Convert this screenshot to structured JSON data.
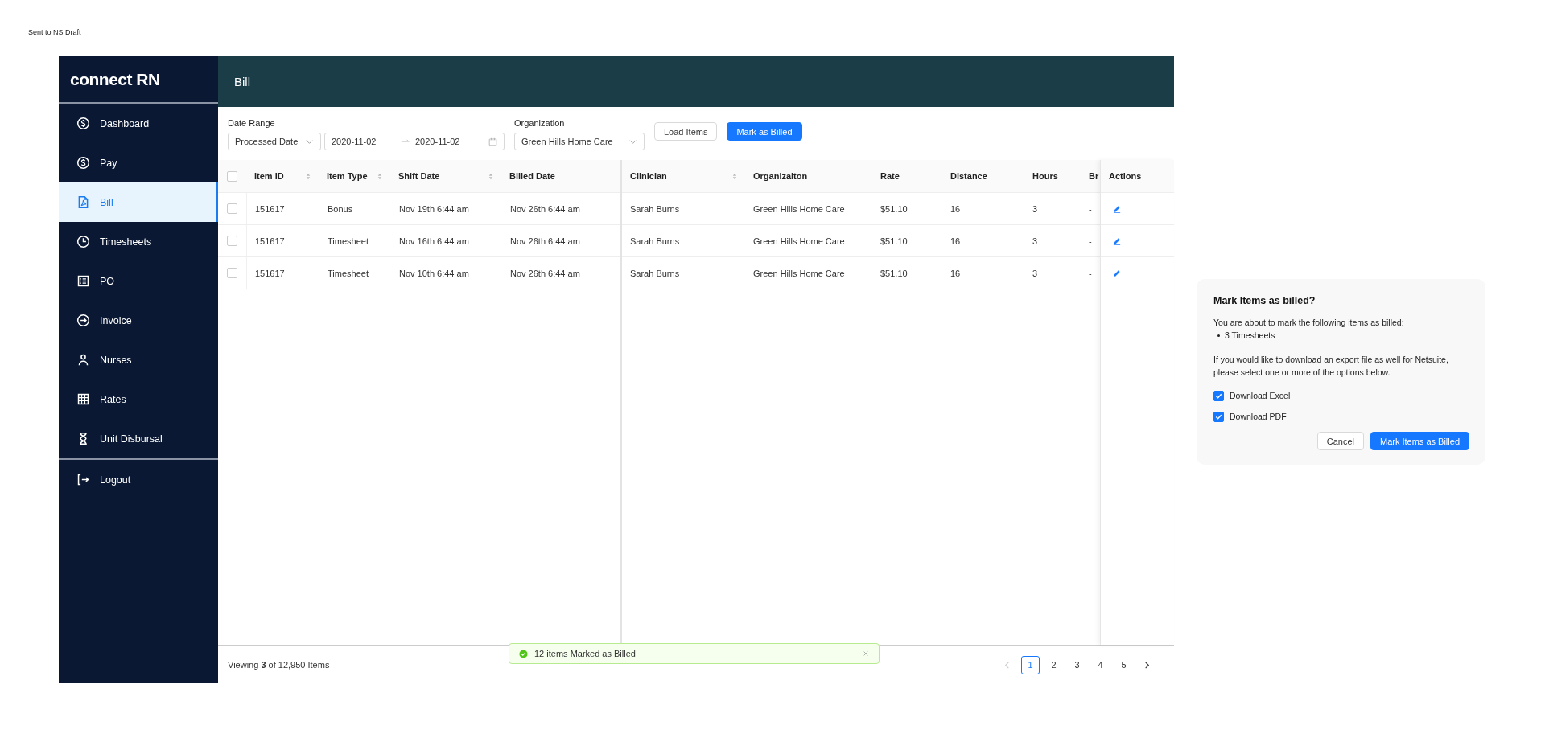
{
  "page_note": "Sent to NS Draft",
  "sidebar": {
    "logo": "connect RN",
    "items": [
      {
        "label": "Dashboard",
        "selected": false
      },
      {
        "label": "Pay",
        "selected": false
      },
      {
        "label": "Bill",
        "selected": true
      },
      {
        "label": "Timesheets",
        "selected": false
      },
      {
        "label": "PO",
        "selected": false
      },
      {
        "label": "Invoice",
        "selected": false
      },
      {
        "label": "Nurses",
        "selected": false
      },
      {
        "label": "Rates",
        "selected": false
      },
      {
        "label": "Unit Disbursal",
        "selected": false
      }
    ],
    "footer_items": [
      {
        "label": "Logout",
        "selected": false
      }
    ]
  },
  "header": {
    "title": "Bill"
  },
  "filters": {
    "date_range_label": "Date Range",
    "date_type": "Processed Date",
    "date_from": "2020-11-02",
    "date_to": "2020-11-02",
    "organization_label": "Organization",
    "organization": "Green Hills Home Care"
  },
  "buttons": [
    {
      "label": "Load Items",
      "kind": "default"
    },
    {
      "label": "Mark as Billed",
      "kind": "primary"
    }
  ],
  "table": {
    "all_checked": false,
    "columns": [
      {
        "label": "Item ID",
        "sortable": true
      },
      {
        "label": "Item Type",
        "sortable": true
      },
      {
        "label": "Shift Date",
        "sortable": true
      },
      {
        "label": "Billed Date",
        "sortable": false
      },
      {
        "label": "Clinician",
        "sortable": true
      },
      {
        "label": "Organizaiton",
        "sortable": false
      },
      {
        "label": "Rate",
        "sortable": false
      },
      {
        "label": "Distance",
        "sortable": false
      },
      {
        "label": "Hours",
        "sortable": false
      },
      {
        "label": "Br",
        "sortable": false
      },
      {
        "label": "Actions",
        "sortable": false
      }
    ],
    "rows": [
      {
        "checked": false,
        "cells": [
          "151617",
          "Bonus",
          "Nov 19th 6:44 am",
          "Nov 26th 6:44 am",
          "Sarah Burns",
          "Green Hills Home Care",
          "$51.10",
          "16",
          "3",
          "-"
        ]
      },
      {
        "checked": false,
        "cells": [
          "151617",
          "Timesheet",
          "Nov 16th 6:44 am",
          "Nov 26th 6:44 am",
          "Sarah Burns",
          "Green Hills Home Care",
          "$51.10",
          "16",
          "3",
          "-"
        ]
      },
      {
        "checked": false,
        "cells": [
          "151617",
          "Timesheet",
          "Nov 10th 6:44 am",
          "Nov 26th 6:44 am",
          "Sarah Burns",
          "Green Hills Home Care",
          "$51.10",
          "16",
          "3",
          "-"
        ]
      }
    ]
  },
  "footer": {
    "summary": "Viewing **3** of 12,950 Items",
    "pages": [
      {
        "label": "1",
        "selected": true
      },
      {
        "label": "2",
        "selected": false
      },
      {
        "label": "3",
        "selected": false
      },
      {
        "label": "4",
        "selected": false
      },
      {
        "label": "5",
        "selected": false
      }
    ],
    "prev_disabled": true,
    "next_disabled": false
  },
  "toast": {
    "message": "12 items Marked as Billed"
  },
  "dialog": {
    "title": "Mark Items as billed?",
    "intro": "You are about to mark the following items as billed:",
    "bullets": [
      "3 Timesheets"
    ],
    "body": "If you would like to download an export file as well for Netsuite, please select one or more of the options below.",
    "options": [
      {
        "label": "Download Excel",
        "checked": true
      },
      {
        "label": "Download PDF",
        "checked": true
      }
    ],
    "buttons": [
      {
        "label": "Cancel",
        "kind": "default"
      },
      {
        "label": "Mark Items as Billed",
        "kind": "primary"
      }
    ]
  }
}
